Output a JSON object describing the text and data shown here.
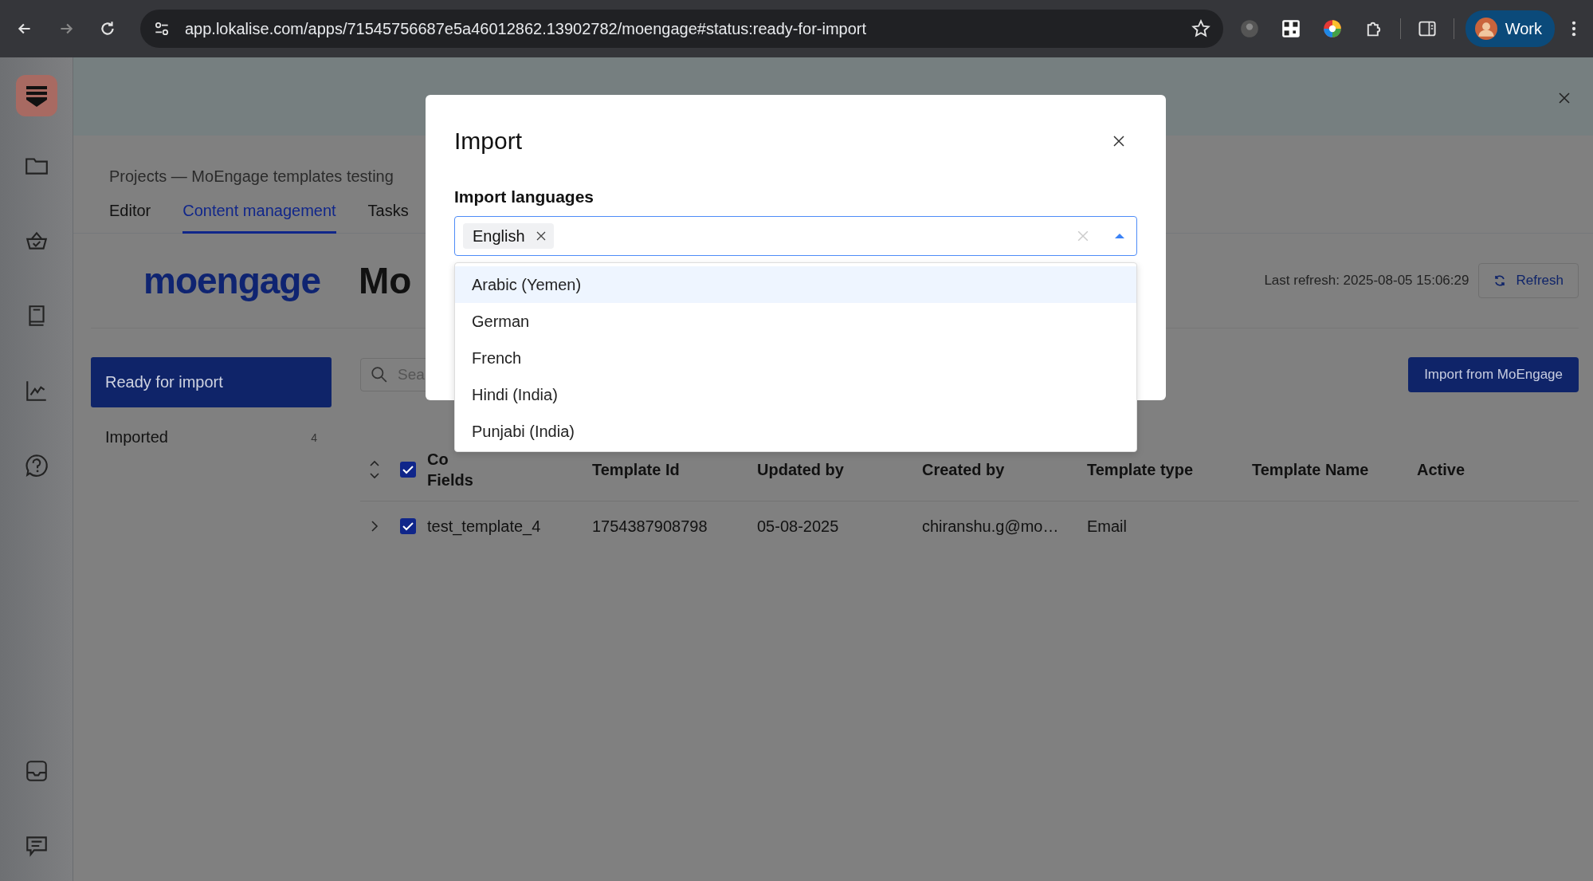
{
  "browser": {
    "url": "app.lokalise.com/apps/71545756687e5a46012862.13902782/moengage#status:ready-for-import",
    "profile": "Work"
  },
  "breadcrumb": "Projects — MoEngage templates testing",
  "tabs": [
    {
      "label": "Editor",
      "selected": false
    },
    {
      "label": "Content management",
      "selected": true
    },
    {
      "label": "Tasks",
      "selected": false
    }
  ],
  "header": {
    "logo": "moengage",
    "title": "Mo",
    "last_refresh": "Last refresh: 2025-08-05 15:06:29",
    "refresh_button": "Refresh"
  },
  "statuses": [
    {
      "label": "Ready for import",
      "selected": true
    },
    {
      "label": "Imported",
      "count": "4",
      "selected": false
    }
  ],
  "search": {
    "placeholder": "Sea"
  },
  "import_button": "Import from MoEngage",
  "table": {
    "all_checked": true,
    "columns": [
      {
        "lines": [
          "Co",
          "Fields"
        ]
      },
      {
        "lines": [
          "Template Id"
        ]
      },
      {
        "lines": [
          "Updated by"
        ]
      },
      {
        "lines": [
          "Created by"
        ]
      },
      {
        "lines": [
          "Template type"
        ]
      },
      {
        "lines": [
          "Template Name"
        ]
      },
      {
        "lines": [
          "Active"
        ]
      }
    ],
    "rows": [
      {
        "expanded": false,
        "checked": true,
        "cells": [
          "test_template_4",
          "1754387908798",
          "05-08-2025",
          "chiranshu.g@mo…",
          "Email"
        ]
      }
    ]
  },
  "modal": {
    "title": "Import",
    "field_label": "Import languages",
    "chips": [
      "English"
    ],
    "open": true,
    "options": [
      {
        "label": "Arabic (Yemen)",
        "selected": true
      },
      {
        "label": "German",
        "selected": false
      },
      {
        "label": "French",
        "selected": false
      },
      {
        "label": "Hindi (India)",
        "selected": false
      },
      {
        "label": "Punjabi (India)",
        "selected": false
      }
    ]
  }
}
